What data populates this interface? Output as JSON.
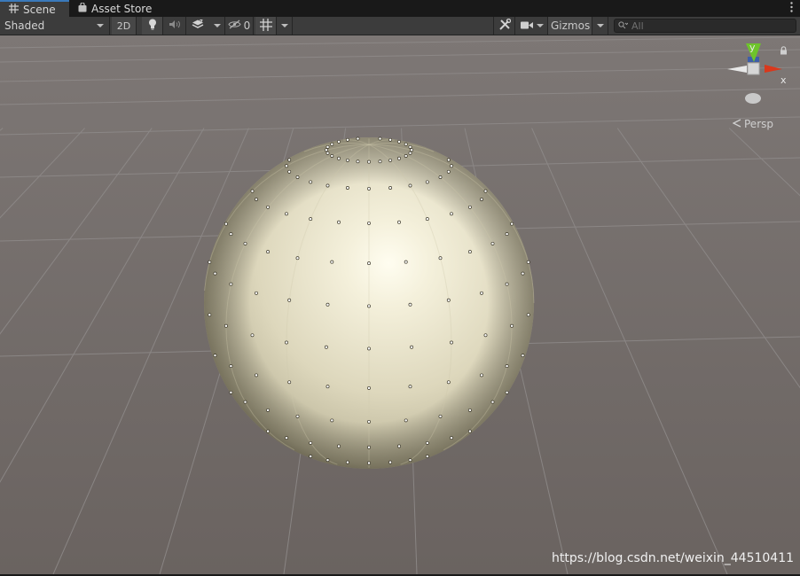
{
  "tabs": [
    {
      "label": "Scene",
      "icon": "grid-icon",
      "active": true
    },
    {
      "label": "Asset Store",
      "icon": "shopping-bag-icon",
      "active": false
    }
  ],
  "toolbar": {
    "shading_mode": "Shaded",
    "mode_2d": "2D",
    "hidden_count": "0",
    "gizmos_label": "Gizmos",
    "search_placeholder": "All"
  },
  "orientation_gizmo": {
    "y_label": "y",
    "x_label": "x",
    "projection_label": "Persp"
  },
  "watermark": "https://blog.csdn.net/weixin_44510411",
  "colors": {
    "ground": "#6b6461",
    "sky": "#7b7573",
    "grid_line": "#8e8a8a",
    "sphere_light": "#fffdee",
    "sphere_mid": "#e6e0c6",
    "sphere_dark": "#6f6a55",
    "axis_y": "#6ec42b",
    "axis_x": "#d9381c",
    "active_tab_accent": "#3a79bb"
  }
}
